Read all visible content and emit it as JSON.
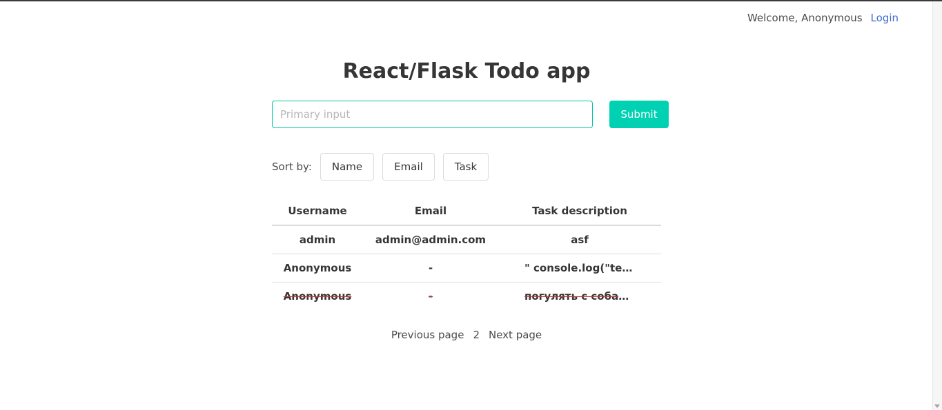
{
  "nav": {
    "welcome": "Welcome, Anonymous",
    "login": "Login"
  },
  "title": "React/Flask Todo app",
  "form": {
    "input_placeholder": "Primary input",
    "input_value": "",
    "submit_label": "Submit"
  },
  "sort": {
    "label": "Sort by:",
    "options": [
      "Name",
      "Email",
      "Task"
    ]
  },
  "table": {
    "headers": [
      "Username",
      "Email",
      "Task description"
    ],
    "rows": [
      {
        "username": "admin",
        "email": "admin@admin.com",
        "task": "asf",
        "done": false
      },
      {
        "username": "Anonymous",
        "email": "-",
        "task": "\" console.log(\"test\")",
        "done": false
      },
      {
        "username": "Anonymous",
        "email": "-",
        "task": "погулять с собакой",
        "done": true
      }
    ]
  },
  "pagination": {
    "prev": "Previous page",
    "current": "2",
    "next": "Next page"
  },
  "colors": {
    "accent": "#00d1b2",
    "link": "#3e6ad0",
    "strike": "#cc3333"
  }
}
